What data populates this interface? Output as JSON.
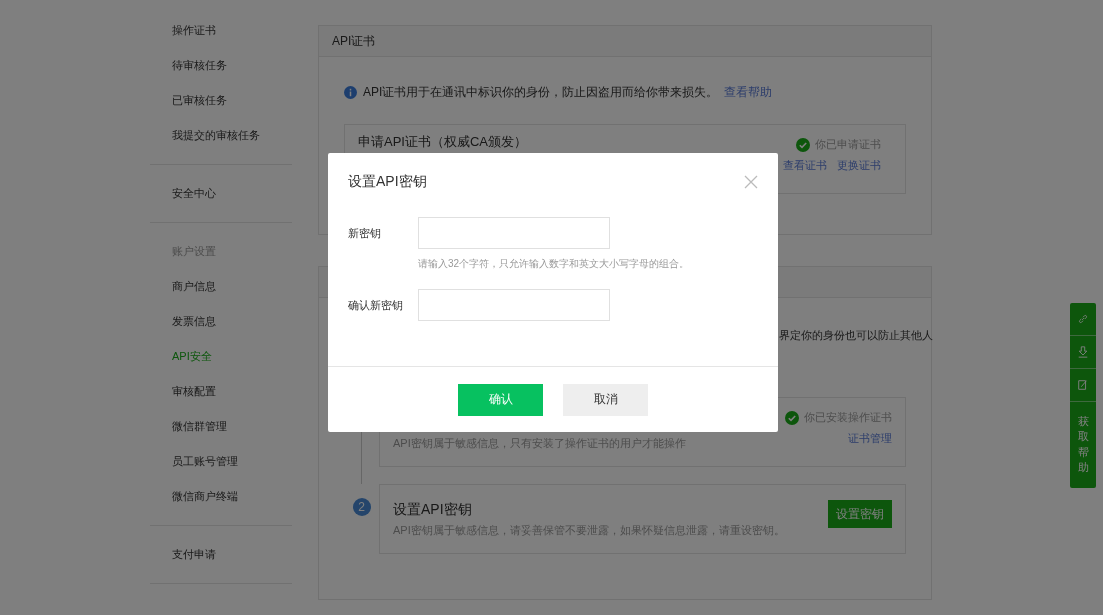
{
  "sidebar": {
    "sections": [
      {
        "items": [
          {
            "label": "操作证书",
            "selected": false
          },
          {
            "label": "待审核任务",
            "selected": false
          },
          {
            "label": "已审核任务",
            "selected": false
          },
          {
            "label": "我提交的审核任务",
            "selected": false
          }
        ]
      },
      {
        "items": [
          {
            "label": "安全中心",
            "selected": false
          }
        ]
      },
      {
        "title": "账户设置",
        "items": [
          {
            "label": "商户信息",
            "selected": false
          },
          {
            "label": "发票信息",
            "selected": false
          },
          {
            "label": "API安全",
            "selected": true
          },
          {
            "label": "审核配置",
            "selected": false
          },
          {
            "label": "微信群管理",
            "selected": false
          },
          {
            "label": "员工账号管理",
            "selected": false
          },
          {
            "label": "微信商户终端",
            "selected": false
          }
        ]
      },
      {
        "items": [
          {
            "label": "支付申请",
            "selected": false
          }
        ]
      }
    ]
  },
  "cert_card": {
    "title": "API证书",
    "notice": "API证书用于在通讯中标识你的身份，防止因盗用而给你带来损失。",
    "help_link": "查看帮助",
    "apply": {
      "title": "申请API证书（权威CA颁发）",
      "status": "你已申请证书",
      "links": [
        "查看证书",
        "更换证书"
      ]
    }
  },
  "key_card": {
    "notice_tail": "界定你的身份也可以防止其他人",
    "steps": [
      {
        "kind": "status",
        "description": "API密钥属于敏感信息，只有安装了操作证书的用户才能操作",
        "status": "你已安装操作证书",
        "links": [
          "证书管理"
        ]
      },
      {
        "kind": "action",
        "number": "2",
        "title": "设置API密钥",
        "description": "API密钥属于敏感信息，请妥善保管不要泄露，如果怀疑信息泄露，请重设密钥。",
        "button": "设置密钥"
      }
    ]
  },
  "help_bar": {
    "label": "获取帮助"
  },
  "dialog": {
    "title": "设置API密钥",
    "fields": [
      {
        "label": "新密钥",
        "hint": "请输入32个字符，只允许输入数字和英文大小写字母的组合。"
      },
      {
        "label": "确认新密钥"
      }
    ],
    "buttons": [
      {
        "label": "确认",
        "kind": "primary"
      },
      {
        "label": "取消",
        "kind": "secondary"
      }
    ]
  }
}
